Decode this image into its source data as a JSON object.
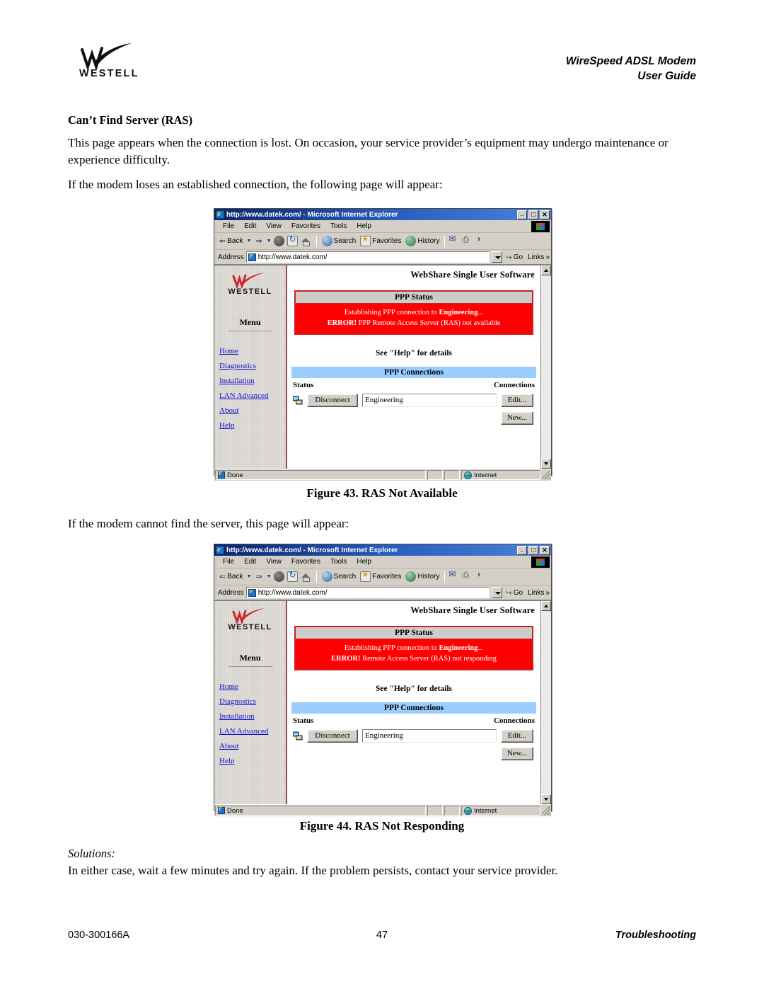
{
  "header": {
    "logo_word": "WESTELL",
    "logo_icon": "westell-swoosh-logo",
    "product_line1": "WireSpeed ADSL Modem",
    "product_line2": "User Guide"
  },
  "section": {
    "title": "Can’t Find Server (RAS)",
    "intro": "This page appears when the connection is lost. On occasion, your service provider’s equipment may undergo maintenance or experience difficulty.",
    "lost_connection": "If the modem loses an established connection, the following page will appear:",
    "cannot_find": "If the modem cannot find the server, this page will appear:",
    "solutions_label": "Solutions:",
    "solutions_text": "In either case, wait a few minutes and try again. If the problem persists, contact your service provider."
  },
  "figures": {
    "caption_43": "Figure 43. RAS Not Available",
    "caption_44": "Figure 44. RAS Not Responding"
  },
  "footer": {
    "doc_number": "030-300166A",
    "page_number": "47",
    "chapter": "Troubleshooting"
  },
  "browser": {
    "title": "http://www.datek.com/ - Microsoft Internet Explorer",
    "caption_buttons": {
      "minimize": "_",
      "maximize": "□",
      "close": "✕"
    },
    "menus": [
      "File",
      "Edit",
      "View",
      "Favorites",
      "Tools",
      "Help"
    ],
    "toolbar": {
      "back": "Back",
      "forward": "",
      "stop": "",
      "refresh": "",
      "home": "",
      "search": "Search",
      "favorites": "Favorites",
      "history": "History",
      "mail": "",
      "print": "",
      "edit": ""
    },
    "address": {
      "label": "Address",
      "value": "http://www.datek.com/",
      "go": "Go",
      "links": "Links",
      "links_chevron": "»"
    },
    "statusbar": {
      "done": "Done",
      "zone": "Internet"
    }
  },
  "webshare": {
    "page_title": "WebShare Single User Software",
    "sidebar": {
      "logo_word": "WESTELL",
      "menu_heading": "Menu",
      "links": [
        "Home",
        "Diagnostics",
        "Installation",
        "LAN Advanced",
        "About",
        "Help"
      ]
    },
    "ppp_status": {
      "header": "PPP Status",
      "line1_prefix": "Establishing PPP connection to ",
      "line1_bold": "Engineering",
      "line1_suffix": "...",
      "error_label": "ERROR!",
      "error_text_available": " PPP Remote Access Server (RAS) not available",
      "error_text_responding": " Remote Access Server (RAS) not responding",
      "bg_color": "#ff0000",
      "header_bg_color": "#cccccc",
      "border_color": "#cc2222"
    },
    "help_line": "See \"Help\" for details",
    "ppp_connections": {
      "header": "PPP Connections",
      "header_bg_color": "#99ccff",
      "col_status": "Status",
      "col_connections": "Connections",
      "disconnect_button": "Disconnect",
      "connection_name": "Engineering",
      "edit_button": "Edit...",
      "new_button": "New..."
    }
  }
}
